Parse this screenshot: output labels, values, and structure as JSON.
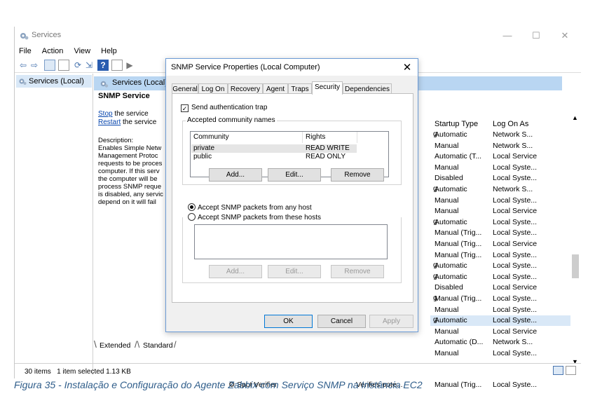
{
  "window": {
    "title": "Services",
    "minimize": "—",
    "maximize": "☐",
    "close": "✕"
  },
  "menu": [
    "File",
    "Action",
    "View",
    "Help"
  ],
  "tree": {
    "item": "Services (Local)"
  },
  "header": {
    "title": "Services (Local)"
  },
  "description": {
    "service_name": "SNMP Service",
    "stop_link": "Stop",
    "stop_rest": " the service",
    "restart_link": "Restart",
    "restart_rest": " the service",
    "lines": [
      "Description:",
      "Enables Simple Netw",
      "Management Protoc",
      "requests to be proces",
      "computer. If this serv",
      "the computer will be",
      "process SNMP reque",
      "is disabled, any servic",
      "depend on it will fail"
    ]
  },
  "table": {
    "headers": {
      "startup": "Startup Type",
      "logon": "Log On As"
    },
    "rows": [
      {
        "g": "g",
        "startup": "Automatic",
        "logon": "Network S..."
      },
      {
        "g": "",
        "startup": "Manual",
        "logon": "Network S..."
      },
      {
        "g": "",
        "startup": "Automatic (T...",
        "logon": "Local Service"
      },
      {
        "g": "",
        "startup": "Manual",
        "logon": "Local Syste..."
      },
      {
        "g": "",
        "startup": "Disabled",
        "logon": "Local Syste..."
      },
      {
        "g": "g",
        "startup": "Automatic",
        "logon": "Network S..."
      },
      {
        "g": "",
        "startup": "Manual",
        "logon": "Local Syste..."
      },
      {
        "g": "",
        "startup": "Manual",
        "logon": "Local Service"
      },
      {
        "g": "g",
        "startup": "Automatic",
        "logon": "Local Syste..."
      },
      {
        "g": "",
        "startup": "Manual (Trig...",
        "logon": "Local Syste..."
      },
      {
        "g": "",
        "startup": "Manual (Trig...",
        "logon": "Local Service"
      },
      {
        "g": "",
        "startup": "Manual (Trig...",
        "logon": "Local Syste..."
      },
      {
        "g": "g",
        "startup": "Automatic",
        "logon": "Local Syste..."
      },
      {
        "g": "g",
        "startup": "Automatic",
        "logon": "Local Syste..."
      },
      {
        "g": "",
        "startup": "Disabled",
        "logon": "Local Service"
      },
      {
        "g": "g",
        "startup": "Manual (Trig...",
        "logon": "Local Syste..."
      },
      {
        "g": "",
        "startup": "Manual",
        "logon": "Local Syste..."
      },
      {
        "g": "g",
        "startup": "Automatic",
        "logon": "Local Syste..."
      },
      {
        "g": "",
        "startup": "Manual",
        "logon": "Local Service"
      },
      {
        "g": "",
        "startup": "Automatic (D...",
        "logon": "Network S..."
      },
      {
        "g": "",
        "startup": "Manual",
        "logon": "Local Syste..."
      }
    ],
    "last_row": {
      "name": "Spot Verifier",
      "desc": "Verifies pote...",
      "startup": "Manual (Trig...",
      "logon": "Local Syste..."
    }
  },
  "bottom_tabs": {
    "extended": "Extended",
    "standard": "Standard"
  },
  "status": {
    "items": "30 items",
    "selected": "1 item selected  1.13 KB"
  },
  "dialog": {
    "title": "SNMP Service Properties (Local Computer)",
    "tabs": [
      "General",
      "Log On",
      "Recovery",
      "Agent",
      "Traps",
      "Security",
      "Dependencies"
    ],
    "send_trap": "Send authentication trap",
    "accepted_label": "Accepted community names",
    "list_headers": {
      "community": "Community",
      "rights": "Rights"
    },
    "communities": [
      {
        "name": "private",
        "rights": "READ WRITE"
      },
      {
        "name": "public",
        "rights": "READ ONLY"
      }
    ],
    "buttons1": {
      "add": "Add...",
      "edit": "Edit...",
      "remove": "Remove"
    },
    "radio_any": "Accept SNMP packets from any host",
    "radio_these": "Accept SNMP packets from these hosts",
    "buttons2": {
      "add": "Add...",
      "edit": "Edit...",
      "remove": "Remove"
    },
    "ok": "OK",
    "cancel": "Cancel",
    "apply": "Apply"
  },
  "caption": "Figura 35 - Instalação e Configuração do Agente Zabbix com Serviço SNMP na Instância EC2"
}
